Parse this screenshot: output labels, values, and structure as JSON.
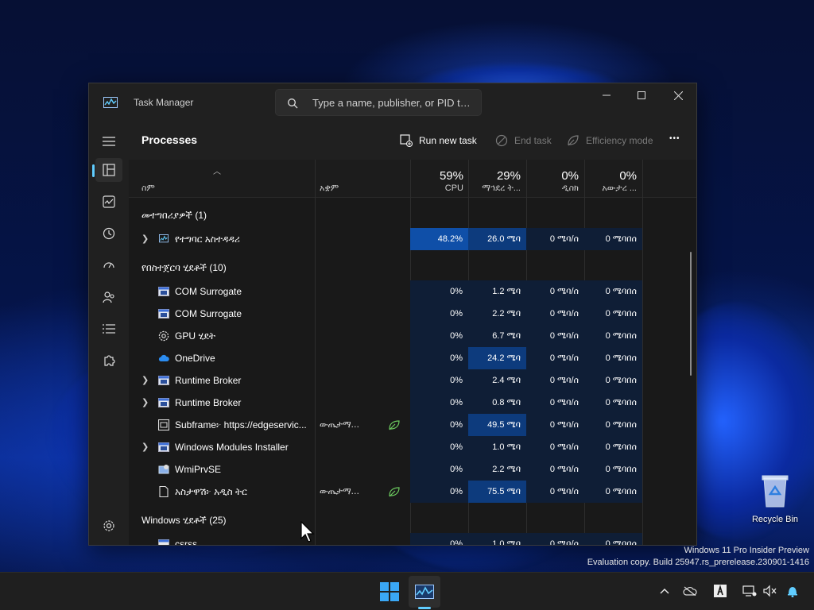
{
  "window": {
    "title": "Task Manager",
    "search_placeholder": "Type a name, publisher, or PID t…"
  },
  "toolbar": {
    "page_title": "Processes",
    "run_new_task": "Run new task",
    "end_task": "End task",
    "efficiency_mode": "Efficiency mode",
    "more": "•••"
  },
  "columns": {
    "name": "ስም",
    "status": "አቋም",
    "cpu_pct": "59%",
    "cpu": "CPU",
    "memory_pct": "29%",
    "memory": "ማኅደረ ት...",
    "disk_pct": "0%",
    "disk": "ዲስክ",
    "network_pct": "0%",
    "network": "አውታረ ..."
  },
  "groups": {
    "apps": "መተግበሪያዎች (1)",
    "background": "የበስተጀርባ ሂደቶች (10)",
    "windows": "Windows ሂደቶች (25)"
  },
  "app_row": {
    "name": "የተግባር አስተዳዳሪ",
    "cpu": "48.2%",
    "memory": "26.0 ሜባ",
    "disk": "0 ሜባ/ሰ",
    "network": "0 ሜባበሰ"
  },
  "background_rows": [
    {
      "name": "COM Surrogate",
      "status": "",
      "cpu": "0%",
      "memory": "1.2 ሜባ",
      "disk": "0 ሜባ/ሰ",
      "network": "0 ሜባበሰ",
      "icon": "window-icon",
      "expand": false,
      "hl": false
    },
    {
      "name": "COM Surrogate",
      "status": "",
      "cpu": "0%",
      "memory": "2.2 ሜባ",
      "disk": "0 ሜባ/ሰ",
      "network": "0 ሜባበሰ",
      "icon": "window-icon",
      "expand": false,
      "hl": false
    },
    {
      "name": "GPU ሂደት",
      "status": "",
      "cpu": "0%",
      "memory": "6.7 ሜባ",
      "disk": "0 ሜባ/ሰ",
      "network": "0 ሜባበሰ",
      "icon": "gear-icon",
      "expand": false,
      "hl": false
    },
    {
      "name": "OneDrive",
      "status": "",
      "cpu": "0%",
      "memory": "24.2 ሜባ",
      "disk": "0 ሜባ/ሰ",
      "network": "0 ሜባበሰ",
      "icon": "cloud-icon",
      "expand": false,
      "hl": true
    },
    {
      "name": "Runtime Broker",
      "status": "",
      "cpu": "0%",
      "memory": "2.4 ሜባ",
      "disk": "0 ሜባ/ሰ",
      "network": "0 ሜባበሰ",
      "icon": "window-icon",
      "expand": true,
      "hl": false
    },
    {
      "name": "Runtime Broker",
      "status": "",
      "cpu": "0%",
      "memory": "0.8 ሜባ",
      "disk": "0 ሜባ/ሰ",
      "network": "0 ሜባበሰ",
      "icon": "window-icon",
      "expand": true,
      "hl": false
    },
    {
      "name": "Subframe፦ https://edgeservic...",
      "status": "ውጤታማ...",
      "cpu": "0%",
      "memory": "49.5 ሜባ",
      "disk": "0 ሜባ/ሰ",
      "network": "0 ሜባበሰ",
      "icon": "frame-icon",
      "expand": false,
      "hl": true
    },
    {
      "name": "Windows Modules Installer",
      "status": "",
      "cpu": "0%",
      "memory": "1.0 ሜባ",
      "disk": "0 ሜባ/ሰ",
      "network": "0 ሜባበሰ",
      "icon": "window-icon",
      "expand": true,
      "hl": false
    },
    {
      "name": "WmiPrvSE",
      "status": "",
      "cpu": "0%",
      "memory": "2.2 ሜባ",
      "disk": "0 ሜባ/ሰ",
      "network": "0 ሜባበሰ",
      "icon": "wmi-icon",
      "expand": false,
      "hl": false
    },
    {
      "name": "አስታዋሽ፦ አዲስ ትር",
      "status": "ውጤታማ...",
      "cpu": "0%",
      "memory": "75.5 ሜባ",
      "disk": "0 ሜባ/ሰ",
      "network": "0 ሜባበሰ",
      "icon": "page-icon",
      "expand": false,
      "hl": true
    }
  ],
  "partial_row": {
    "name": "csrss",
    "cpu": "0%",
    "memory": "1.0 ሜባ",
    "disk": "0 ሜባ/ሰ",
    "network": "0 ሜባበሰ"
  },
  "desktop": {
    "recycle_bin": "Recycle Bin",
    "watermark_line1": "Windows 11 Pro Insider Preview",
    "watermark_line2": "Evaluation copy. Build 25947.rs_prerelease.230901-1416"
  },
  "colors": {
    "accent": "#60cdff",
    "heat_strong": "#0f4fa8",
    "heat_light": "#0d2a52",
    "heat_faint": "#0f1e36"
  }
}
